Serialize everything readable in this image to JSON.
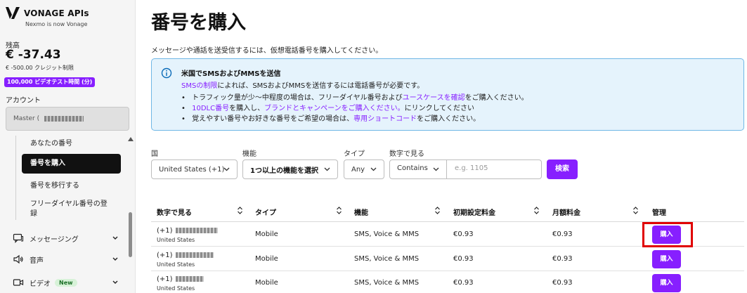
{
  "sidebar": {
    "brand": "VONAGE APIs",
    "brand_sub": "Nexmo is now Vonage",
    "balance_label": "残高",
    "balance_value": "€ -37.43",
    "balance_limit": "€ -500.00 クレジット制限",
    "promo_badge": "100,000 ビデオテスト時間 (分)",
    "account_label": "アカウント",
    "account_value": "Master (",
    "sub_items": [
      {
        "label": "あなたの番号"
      },
      {
        "label": "番号を購入"
      },
      {
        "label": "番号を移行する"
      },
      {
        "label": "フリーダイヤル番号の登録"
      }
    ],
    "sections": [
      {
        "label": "メッセージング"
      },
      {
        "label": "音声"
      },
      {
        "label": "ビデオ",
        "badge": "New"
      }
    ]
  },
  "main": {
    "title": "番号を購入",
    "description": "メッセージや通話を送受信するには、仮想電話番号を購入してください。",
    "info": {
      "title": "米国でSMSおよびMMSを送信",
      "line1_link": "SMSの制限",
      "line1_text": "によれば、SMSおよびMMSを送信するには電話番号が必要です。",
      "b1_text": "トラフィック量が少～中程度の場合は、フリーダイヤル番号および",
      "b1_link": "ユースケースを確認",
      "b1_tail": "をご購入ください。",
      "b2_link1": "10DLC番号",
      "b2_text": "を購入し、",
      "b2_link2": "ブランドとキャンペーンをご購入ください。",
      "b2_tail": "にリンクしてください",
      "b3_text": "覚えやすい番号やお好きな番号をご希望の場合は、",
      "b3_link": "専用ショートコード",
      "b3_tail": "をご購入ください。"
    },
    "filters": {
      "country_label": "国",
      "country_value": "United States (+1)",
      "feature_label": "機能",
      "feature_value": "1つ以上の機能を選択",
      "type_label": "タイプ",
      "type_value": "Any",
      "number_label": "数字で見る",
      "match_value": "Contains",
      "search_placeholder": "e.g. 1105",
      "search_button": "検索"
    },
    "table": {
      "headers": [
        "数字で見る",
        "タイプ",
        "機能",
        "初期設定料金",
        "月額料金",
        "管理"
      ],
      "rows": [
        {
          "prefix": "(+1)",
          "country": "United States",
          "type": "Mobile",
          "features": "SMS, Voice & MMS",
          "setup": "€0.93",
          "monthly": "€0.93",
          "action": "購入"
        },
        {
          "prefix": "(+1)",
          "country": "United States",
          "type": "Mobile",
          "features": "SMS, Voice & MMS",
          "setup": "€0.93",
          "monthly": "€0.93",
          "action": "購入"
        },
        {
          "prefix": "(+1)",
          "country": "United States",
          "type": "Mobile",
          "features": "SMS, Voice & MMS",
          "setup": "€0.93",
          "monthly": "€0.93",
          "action": "購入"
        }
      ]
    }
  },
  "colors": {
    "accent": "#871fff",
    "highlight": "#e00000",
    "info_bg": "#e5f3fc"
  }
}
